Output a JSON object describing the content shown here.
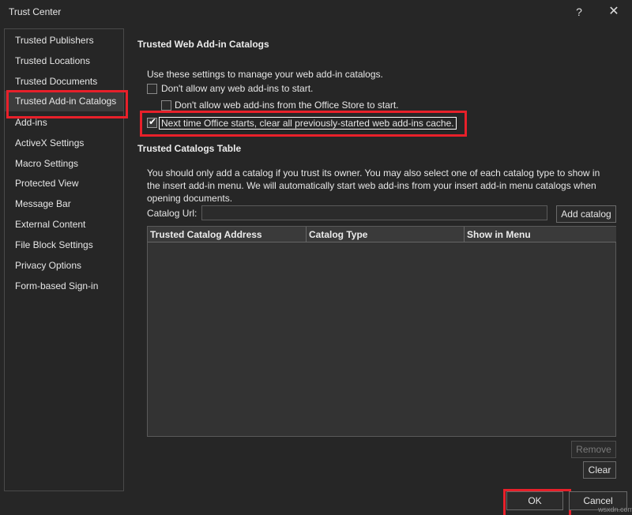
{
  "window": {
    "title": "Trust Center",
    "help": "?",
    "close": "✕"
  },
  "sidebar": {
    "items": [
      {
        "label": "Trusted Publishers"
      },
      {
        "label": "Trusted Locations"
      },
      {
        "label": "Trusted Documents"
      },
      {
        "label": "Trusted Add-in Catalogs",
        "active": true
      },
      {
        "label": "Add-ins"
      },
      {
        "label": "ActiveX Settings"
      },
      {
        "label": "Macro Settings"
      },
      {
        "label": "Protected View"
      },
      {
        "label": "Message Bar"
      },
      {
        "label": "External Content"
      },
      {
        "label": "File Block Settings"
      },
      {
        "label": "Privacy Options"
      },
      {
        "label": "Form-based Sign-in"
      }
    ]
  },
  "main": {
    "section1_title": "Trusted Web Add-in Catalogs",
    "intro": "Use these settings to manage your web add-in catalogs.",
    "cb1": {
      "label": "Don't allow any web add-ins to start.",
      "checked": false
    },
    "cb2": {
      "label": "Don't allow web add-ins from the Office Store to start.",
      "checked": false
    },
    "cb3": {
      "label": "Next time Office starts, clear all previously-started web add-ins cache.",
      "checked": true
    },
    "section2_title": "Trusted Catalogs Table",
    "paragraph": "You should only add a catalog if you trust its owner. You may also select one of each catalog type to show in the insert add-in menu. We will automatically start web add-ins from your insert add-in menu catalogs when opening documents.",
    "catalog_url_label": "Catalog Url:",
    "catalog_url_value": "",
    "add_catalog_label": "Add catalog",
    "table": {
      "columns": [
        "Trusted Catalog Address",
        "Catalog Type",
        "Show in Menu"
      ],
      "rows": []
    },
    "remove_label": "Remove",
    "clear_label": "Clear"
  },
  "footer": {
    "ok_label": "OK",
    "cancel_label": "Cancel"
  },
  "watermark": "wsxdn.com",
  "colors": {
    "background": "#262626",
    "highlight_red": "#e8202a"
  }
}
